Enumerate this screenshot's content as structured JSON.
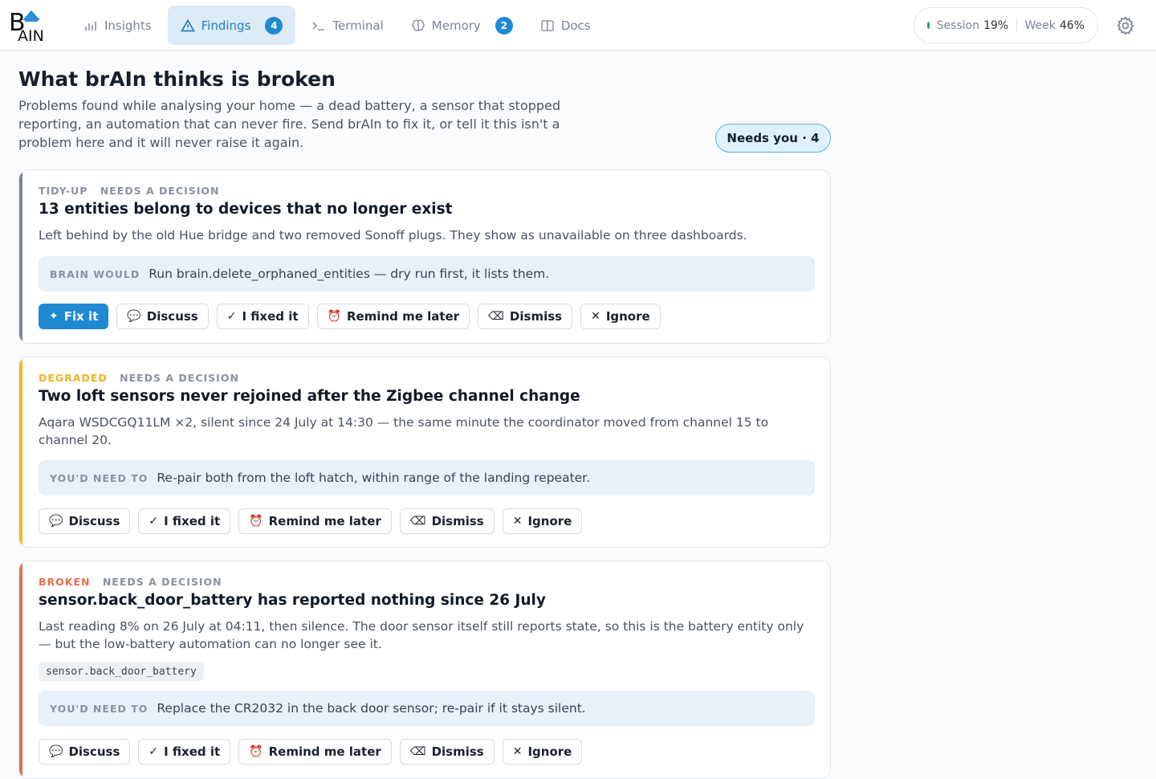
{
  "app": {
    "logo_text_top": "B",
    "logo_text_bottom": "AIN"
  },
  "nav": [
    {
      "label": "Insights",
      "icon": "bar-chart-icon",
      "active": false,
      "badge": null
    },
    {
      "label": "Findings",
      "icon": "warning-triangle-icon",
      "active": true,
      "badge": "4"
    },
    {
      "label": "Terminal",
      "icon": "terminal-prompt-icon",
      "active": false,
      "badge": null
    },
    {
      "label": "Memory",
      "icon": "brain-icon",
      "active": false,
      "badge": "2"
    },
    {
      "label": "Docs",
      "icon": "book-icon",
      "active": false,
      "badge": null
    }
  ],
  "usage": {
    "session_label": "Session",
    "session_value": "19%",
    "week_label": "Week",
    "week_value": "46%",
    "status_color": "#1aa34a"
  },
  "header": {
    "title": "What brAIn thinks is broken",
    "subtitle": "Problems found while analysing your home — a dead battery, a sensor that stopped reporting, an automation that can never fire. Send brAIn to fix it, or tell it this isn't a problem here and it will never raise it again.",
    "needs_you": "Needs you · 4"
  },
  "colors": {
    "brand": "#1f8ad2",
    "tidy": "#7d8897",
    "degraded": "#f2b824",
    "broken": "#e2714a"
  },
  "findings": [
    {
      "category": "TIDY-UP",
      "status": "NEEDS A DECISION",
      "title": "13 entities belong to devices that no longer exist",
      "description": "Left behind by the old Hue bridge and two removed Sonoff plugs. They show as unavailable on three dashboards.",
      "action_label": "BRAIN WOULD",
      "action_text": "Run brain.delete_orphaned_entities — dry run first, it lists them.",
      "fix_label": "Fix it"
    },
    {
      "category": "DEGRADED",
      "status": "NEEDS A DECISION",
      "title": "Two loft sensors never rejoined after the Zigbee channel change",
      "description": "Aqara WSDCGQ11LM ×2, silent since 24 July at 14:30 — the same minute the coordinator moved from channel 15 to channel 20.",
      "action_label": "YOU'D NEED TO",
      "action_text": "Re-pair both from the loft hatch, within range of the landing repeater."
    },
    {
      "category": "BROKEN",
      "status": "NEEDS A DECISION",
      "title": "sensor.back_door_battery has reported nothing since 26 July",
      "description": "Last reading 8% on 26 July at 04:11, then silence. The door sensor itself still reports state, so this is the battery entity only — but the low-battery automation can no longer see it.",
      "entity": "sensor.back_door_battery",
      "action_label": "YOU'D NEED TO",
      "action_text": "Replace the CR2032 in the back door sensor; re-pair if it stays silent."
    }
  ],
  "buttons": {
    "discuss": "Discuss",
    "fixed": "I fixed it",
    "remind": "Remind me later",
    "dismiss": "Dismiss",
    "ignore": "Ignore"
  }
}
